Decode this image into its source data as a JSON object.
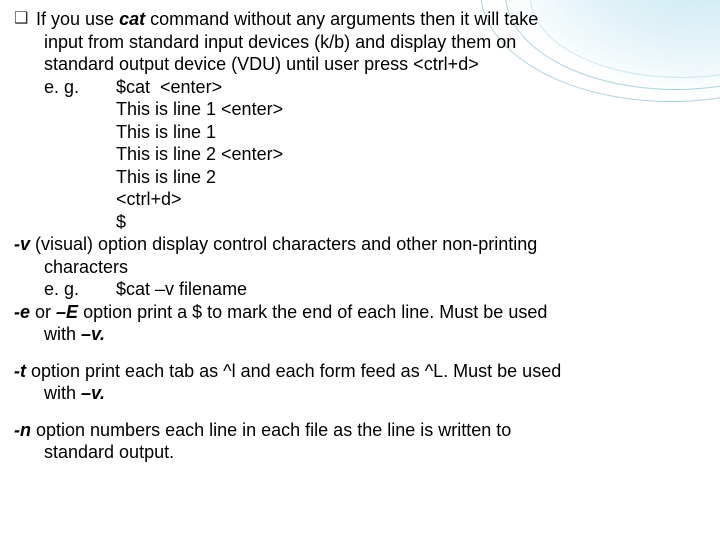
{
  "bullet_glyph": "❑",
  "main": {
    "intro_1": "If you use ",
    "intro_cmd": "cat",
    "intro_2": " command without any arguments then it will take",
    "intro_line2": "input from standard input devices (k/b) and display them on",
    "intro_line3": "standard output device (VDU) until user press <ctrl+d>",
    "eg_label": "e. g.",
    "eg_lines": [
      "$cat  <enter>",
      "This is line 1 <enter>",
      "This is line 1",
      "This is line 2 <enter>",
      "This is line 2",
      "<ctrl+d>",
      "$"
    ]
  },
  "v_opt": {
    "flag": "-v",
    "line1_rest": " (visual) option display control characters and other  non-printing",
    "line2": "characters",
    "eg_label": "e. g.",
    "eg_cmd": "$cat –v filename"
  },
  "e_opt": {
    "flag_e": "-e",
    "mid": " or ",
    "flag_E": "–E",
    "line1_rest": " option print a $ to mark the end of each line. Must be used",
    "line2_pre": "with ",
    "line2_flag": "–v.",
    "line2_post": ""
  },
  "t_opt": {
    "flag": "-t",
    "line1_rest": " option print each tab as ^l and each form feed as ^L. Must be used",
    "line2_pre": "with ",
    "line2_flag": "–v.",
    "line2_post": ""
  },
  "n_opt": {
    "flag": "-n",
    "line1_rest": " option numbers each line in each file as the line is written to",
    "line2": "standard output."
  }
}
